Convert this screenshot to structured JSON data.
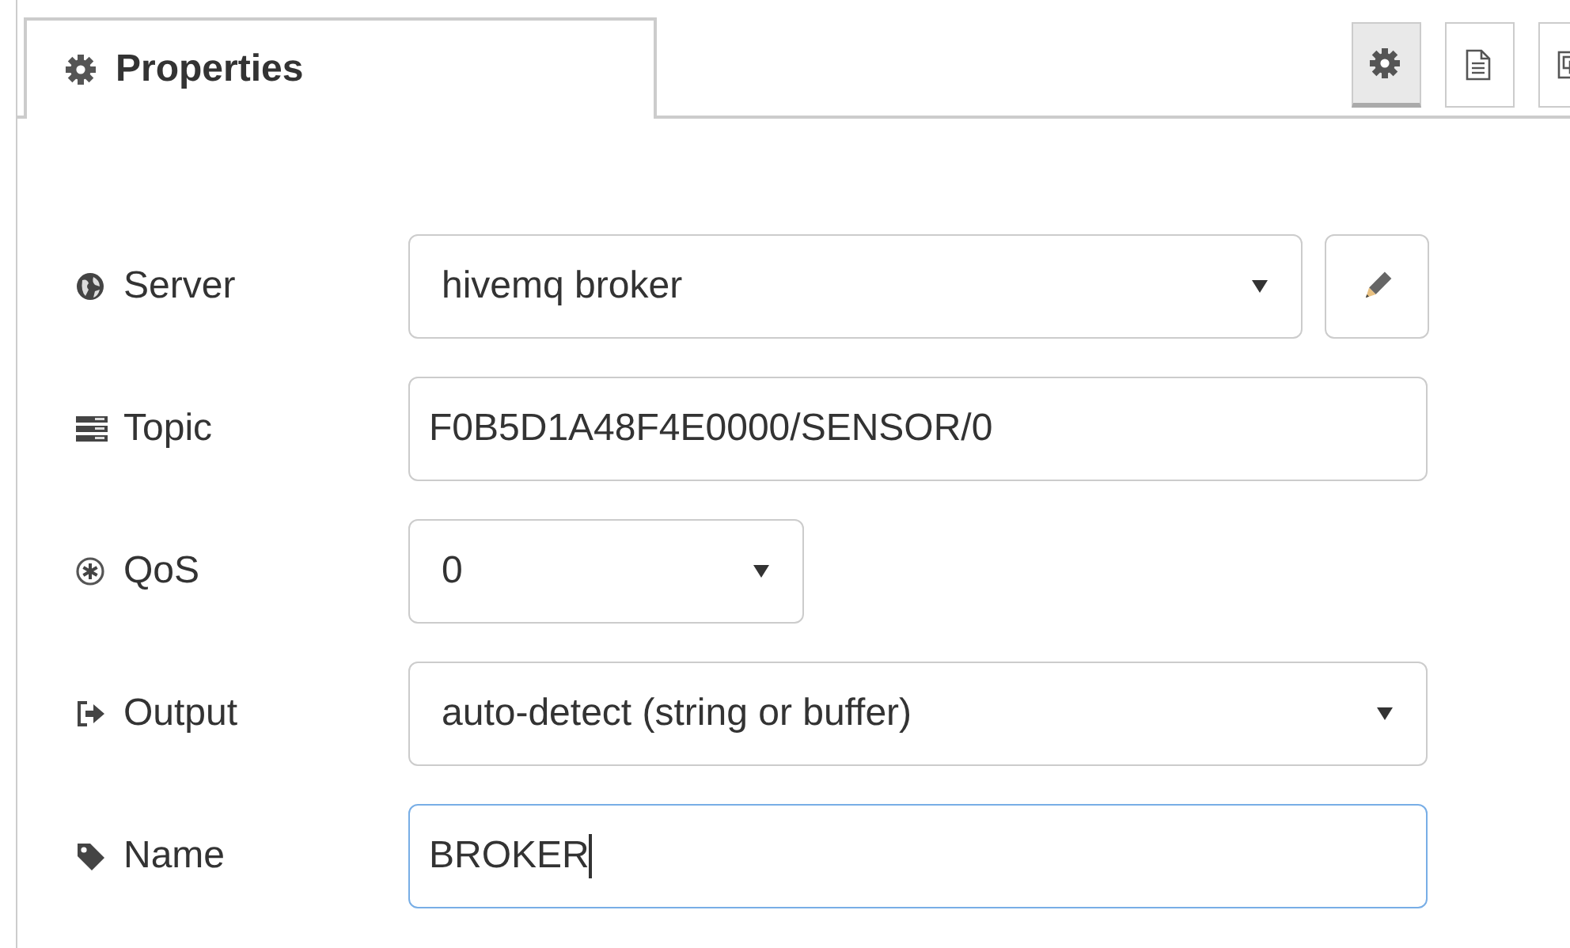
{
  "tabs": [
    {
      "label": "Properties",
      "selected": true
    }
  ],
  "toolbar": [
    {
      "kind": "gear",
      "selected": true
    },
    {
      "kind": "document",
      "selected": false
    },
    {
      "kind": "frame",
      "selected": false
    }
  ],
  "fields": [
    {
      "kind": "select",
      "label": "Server",
      "value": "hivemq broker",
      "edit_button": true
    },
    {
      "kind": "text",
      "label": "Topic",
      "value": "F0B5D1A48F4E0000/SENSOR/0",
      "focused": false
    },
    {
      "kind": "select",
      "label": "QoS",
      "value": "0"
    },
    {
      "kind": "select",
      "label": "Output",
      "value": "auto-detect (string or buffer)"
    },
    {
      "kind": "text",
      "label": "Name",
      "value": "BROKER",
      "focused": true
    }
  ]
}
